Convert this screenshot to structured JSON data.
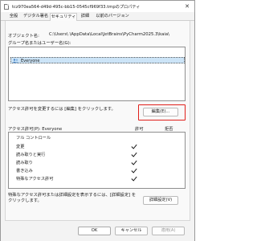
{
  "window": {
    "title": "tcz970ea564-d49d-495c-bb15-0545cf969f33.tmpのプロパティ",
    "close_glyph": "✕"
  },
  "tabs": [
    {
      "label": "全般",
      "active": false
    },
    {
      "label": "デジタル署名",
      "active": false
    },
    {
      "label": "セキュリティ",
      "active": true
    },
    {
      "label": "詳細",
      "active": false
    },
    {
      "label": "以前のバージョン",
      "active": false
    }
  ],
  "object_name": {
    "label": "オブジェクト名:",
    "value": "C:\\Users\\           \\AppData\\Local\\JetBrains\\PyCharm2025.3\\kaia\\"
  },
  "groups": {
    "label": "グループ名またはユーザー名(G):",
    "items": [
      {
        "name": "Everyone",
        "icon": "users-group-icon",
        "selected": true
      }
    ]
  },
  "change_hint": "アクセス許可を変更するには [編集] をクリックします。",
  "edit_button": "編集(E)...",
  "permissions": {
    "label": "アクセス許可(P): Everyone",
    "allow_header": "許可",
    "deny_header": "拒否",
    "rows": [
      {
        "name": "フル コントロール",
        "allow": false
      },
      {
        "name": "変更",
        "allow": true
      },
      {
        "name": "読み取りと実行",
        "allow": true
      },
      {
        "name": "読み取り",
        "allow": true
      },
      {
        "name": "書き込み",
        "allow": true
      },
      {
        "name": "特殊なアクセス許可",
        "allow": true
      }
    ]
  },
  "special_hint": "特殊なアクセス許可または詳細設定を表示するには、[詳細設定] をクリックします。",
  "advanced_button": "詳細設定(V)",
  "footer": {
    "ok": "OK",
    "cancel": "キャンセル",
    "apply": "適用(A)"
  },
  "colors": {
    "highlight": "#e0201b",
    "selection": "#cce4f7"
  }
}
